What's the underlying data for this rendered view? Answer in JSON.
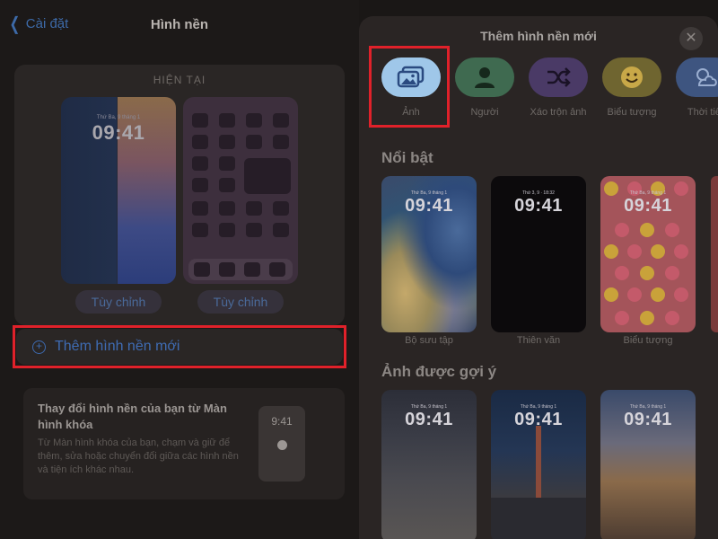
{
  "left": {
    "back_label": "Cài đặt",
    "title": "Hình nền",
    "current_label": "HIỆN TẠI",
    "lock_preview": {
      "date": "Thứ Ba, 9 tháng 1",
      "time": "09:41"
    },
    "customize_lock": "Tùy chỉnh",
    "customize_home": "Tùy chỉnh",
    "add_wallpaper": "Thêm hình nền mới",
    "info": {
      "title": "Thay đổi hình nền của bạn từ Màn hình khóa",
      "body": "Từ Màn hình khóa của bạn, chạm và giữ để thêm, sửa hoặc chuyển đổi giữa các hình nền và tiện ích khác nhau.",
      "mini_time": "9:41"
    }
  },
  "sheet": {
    "title": "Thêm hình nền mới",
    "categories": [
      {
        "label": "Ảnh",
        "icon": "photos-icon",
        "color": "#9fc7e9"
      },
      {
        "label": "Người",
        "icon": "person-icon",
        "color": "#3f6a50"
      },
      {
        "label": "Xáo trộn ảnh",
        "icon": "shuffle-icon",
        "color": "#4a3a66"
      },
      {
        "label": "Biểu tượng",
        "icon": "emoji-icon",
        "color": "#6f6530"
      },
      {
        "label": "Thời tiết",
        "icon": "weather-icon",
        "color": "#3e5580"
      }
    ],
    "featured_title": "Nổi bật",
    "featured": [
      {
        "label": "Bộ sưu tập",
        "date": "Thứ Ba, 9 tháng 1",
        "time": "09:41"
      },
      {
        "label": "Thiên văn",
        "date": "Thứ 3, 9 · 18:32",
        "time": "09:41"
      },
      {
        "label": "Biểu tượng",
        "date": "Thứ Ba, 9 tháng 1",
        "time": "09:41"
      }
    ],
    "suggested_title": "Ảnh được gợi ý",
    "suggested": [
      {
        "date": "Thứ Ba, 9 tháng 1",
        "time": "09:41"
      },
      {
        "date": "Thứ Ba, 9 tháng 1",
        "time": "09:41"
      },
      {
        "date": "Thứ Ba, 9 tháng 1",
        "time": "09:41"
      }
    ]
  },
  "highlight_color": "#e0212a",
  "accent_color": "#3f6cb4"
}
